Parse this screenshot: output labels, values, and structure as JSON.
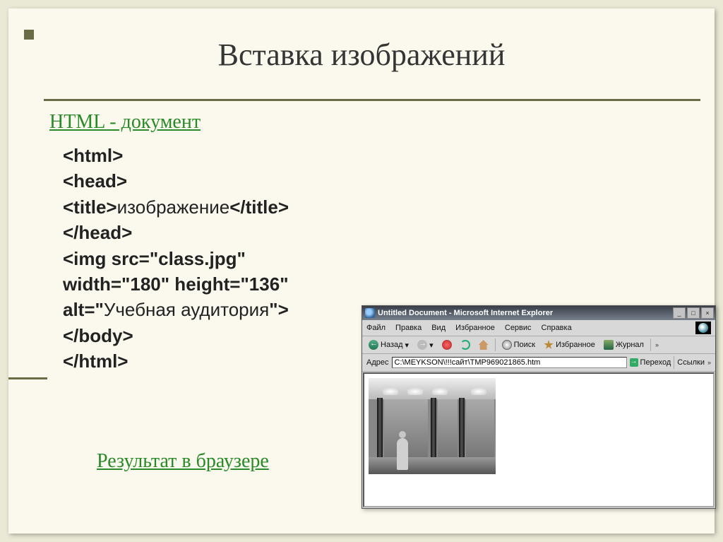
{
  "title": "Вставка изображений",
  "html_doc_label": "HTML - документ",
  "code": {
    "l1": "<html>",
    "l2": "<head>",
    "l3a": "<title>",
    "l3b": "изображение",
    "l3c": "</title>",
    "l4": "</head>",
    "l5": "<img src=\"class.jpg\"",
    "l6": "width=\"180\" height=\"136\"",
    "l7a": "alt=\"",
    "l7b": "Учебная аудитория",
    "l7c": "\">",
    "l8": "</body>",
    "l9": "</html>"
  },
  "result_label": "Результат в браузере",
  "browser": {
    "title": "Untitled Document - Microsoft Internet Explorer",
    "menu": {
      "file": "Файл",
      "edit": "Правка",
      "view": "Вид",
      "favorites": "Избранное",
      "tools": "Сервис",
      "help": "Справка"
    },
    "toolbar": {
      "back": "Назад",
      "search": "Поиск",
      "favorites": "Избранное",
      "journal": "Журнал"
    },
    "addr_label": "Адрес",
    "addr_value": "C:\\MEYKSON\\!!!сайт\\TMP969021865.htm",
    "go": "Переход",
    "links": "Ссылки"
  }
}
